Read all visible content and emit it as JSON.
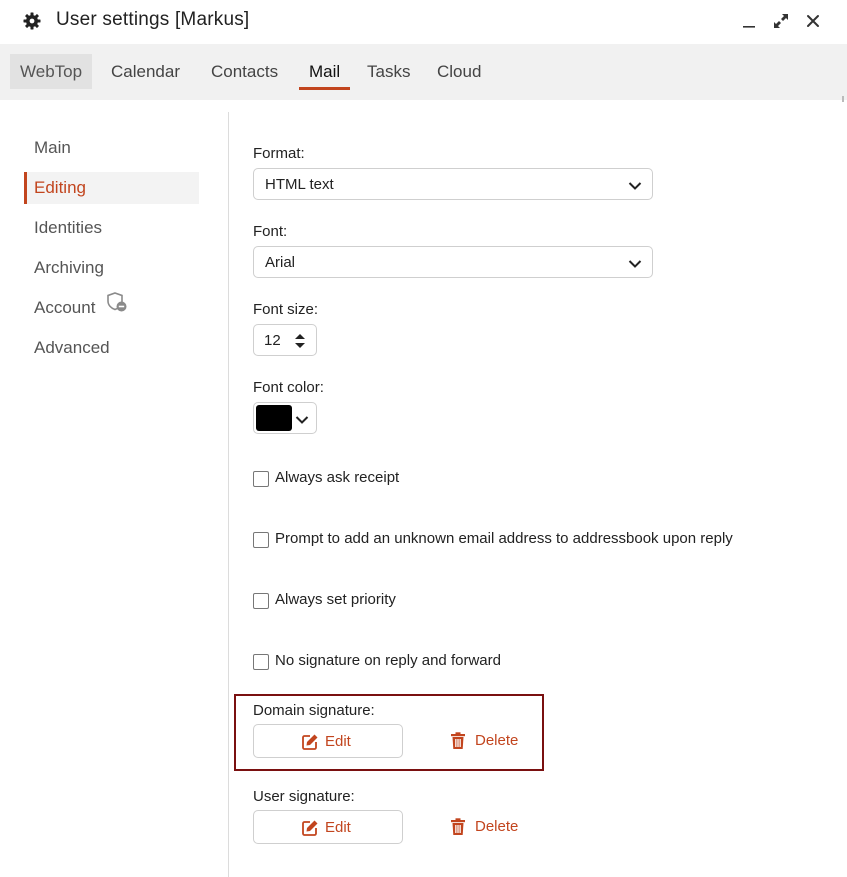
{
  "window": {
    "title": "User settings [Markus]"
  },
  "tabs": [
    {
      "label": "WebTop"
    },
    {
      "label": "Calendar"
    },
    {
      "label": "Contacts"
    },
    {
      "label": "Mail"
    },
    {
      "label": "Tasks"
    },
    {
      "label": "Cloud"
    }
  ],
  "nav": {
    "items": [
      {
        "label": "Main"
      },
      {
        "label": "Editing"
      },
      {
        "label": "Identities"
      },
      {
        "label": "Archiving"
      },
      {
        "label": "Account"
      },
      {
        "label": "Advanced"
      }
    ]
  },
  "form": {
    "format": {
      "label": "Format:",
      "value": "HTML text"
    },
    "font": {
      "label": "Font:",
      "value": "Arial"
    },
    "font_size": {
      "label": "Font size:",
      "value": "12"
    },
    "font_color": {
      "label": "Font color:",
      "value": "#000000"
    },
    "checkboxes": [
      {
        "label": "Always ask receipt",
        "checked": false
      },
      {
        "label": "Prompt to add an unknown email address to addressbook upon reply",
        "checked": false
      },
      {
        "label": "Always set priority",
        "checked": false
      },
      {
        "label": "No signature on reply and forward",
        "checked": false
      }
    ],
    "domain_signature": {
      "label": "Domain signature:",
      "edit_label": "Edit",
      "delete_label": "Delete"
    },
    "user_signature": {
      "label": "User signature:",
      "edit_label": "Edit",
      "delete_label": "Delete"
    }
  },
  "colors": {
    "accent": "#c2451e",
    "highlight_border": "#7a1010",
    "tabbar_bg": "#f1f1f1"
  }
}
